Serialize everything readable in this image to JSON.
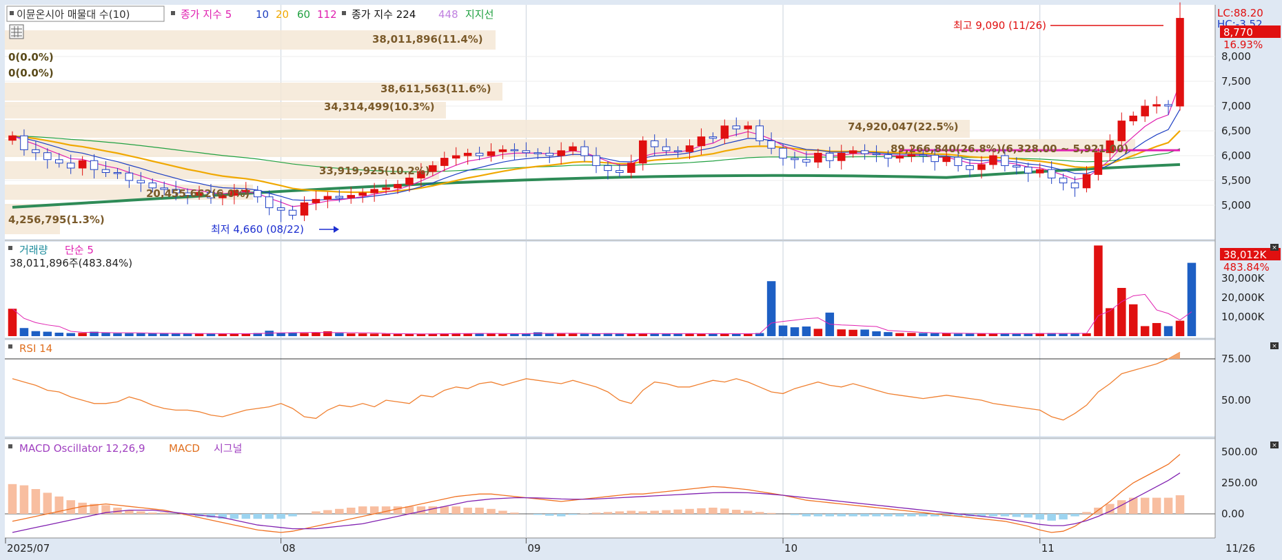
{
  "legend": {
    "item_name": "이뮨온시아 매물대 수(10)",
    "ma_label": "종가 지수 5",
    "ma10": "10",
    "ma20": "20",
    "ma60": "60",
    "ma112": "112",
    "ma224_label": "종가 지수 224",
    "ma448": "448",
    "support": "지지선"
  },
  "right_info": {
    "lc": "LC:88.20",
    "hc": "HC:-3.52",
    "price_tag": "8,770",
    "pct_tag": "16.93%"
  },
  "price_panel": {
    "high_label": "최고 9,090 (11/26)",
    "low_label": "최저 4,660 (08/22)",
    "y_ticks": [
      "8,000",
      "7,500",
      "7,000",
      "6,500",
      "6,000",
      "5,500",
      "5,000"
    ],
    "volume_profile": [
      {
        "label": "38,011,896(11.4%)"
      },
      {
        "label": "0(0.0%)"
      },
      {
        "label": "0(0.0%)"
      },
      {
        "label": "38,611,563(11.6%)"
      },
      {
        "label": "34,314,499(10.3%)"
      },
      {
        "label": "74,920,047(22.5%)"
      },
      {
        "label": "89,266,840(26.8%)(6,328.00 ~ 5,921.00)"
      },
      {
        "label": "33,919,925(10.2%)"
      },
      {
        "label": "20,455,662(6.0%)"
      },
      {
        "label": "4,256,795(1.3%)"
      }
    ]
  },
  "volume_panel": {
    "title": "거래량",
    "ma_label": "단순 5",
    "info": "38,011,896주(483.84%)",
    "y_ticks": [
      "30,000K",
      "20,000K",
      "10,000K"
    ],
    "tag_value": "38,012K",
    "tag_pct": "483.84%"
  },
  "rsi_panel": {
    "title": "RSI 14",
    "y_ticks": [
      "75.00",
      "50.00"
    ]
  },
  "macd_panel": {
    "title": "MACD Oscillator 12,26,9",
    "macd_label": "MACD",
    "signal_label": "시그널",
    "y_ticks": [
      "500.00",
      "250.00",
      "0.00"
    ]
  },
  "x_axis": {
    "labels": [
      "2025/07",
      "08",
      "09",
      "10",
      "11"
    ],
    "end_label": "11/26"
  },
  "chart_data": [
    {
      "type": "candlestick",
      "title": "이뮨온시아",
      "x": [
        "07/01",
        "07/02",
        "07/03",
        "07/04",
        "07/07",
        "07/08",
        "07/09",
        "07/10",
        "07/11",
        "07/14",
        "07/15",
        "07/16",
        "07/17",
        "07/18",
        "07/21",
        "07/22",
        "07/23",
        "07/24",
        "07/25",
        "07/28",
        "07/29",
        "07/30",
        "07/31",
        "08/01",
        "08/04",
        "08/05",
        "08/06",
        "08/07",
        "08/08",
        "08/11",
        "08/12",
        "08/13",
        "08/14",
        "08/18",
        "08/19",
        "08/20",
        "08/21",
        "08/22",
        "08/25",
        "08/26",
        "08/27",
        "08/28",
        "08/29",
        "09/01",
        "09/02",
        "09/03",
        "09/04",
        "09/05",
        "09/08",
        "09/09",
        "09/10",
        "09/11",
        "09/12",
        "09/15",
        "09/16",
        "09/17",
        "09/18",
        "09/19",
        "09/22",
        "09/23",
        "09/24",
        "09/25",
        "09/26",
        "09/29",
        "09/30",
        "10/01",
        "10/02",
        "10/10",
        "10/13",
        "10/14",
        "10/15",
        "10/16",
        "10/17",
        "10/20",
        "10/21",
        "10/22",
        "10/23",
        "10/24",
        "10/27",
        "10/28",
        "10/29",
        "10/30",
        "10/31",
        "11/03",
        "11/04",
        "11/05",
        "11/06",
        "11/07",
        "11/10",
        "11/11",
        "11/12",
        "11/13",
        "11/14",
        "11/17",
        "11/18",
        "11/19",
        "11/20",
        "11/21",
        "11/24",
        "11/25",
        "11/26"
      ],
      "open": [
        6310,
        6400,
        6120,
        6060,
        5920,
        5850,
        5750,
        5900,
        5720,
        5660,
        5650,
        5500,
        5450,
        5350,
        5320,
        5250,
        5200,
        5260,
        5150,
        5200,
        5300,
        5300,
        5170,
        4950,
        4900,
        4800,
        5050,
        5120,
        5180,
        5150,
        5200,
        5250,
        5320,
        5350,
        5420,
        5550,
        5680,
        5800,
        5950,
        6000,
        6050,
        6000,
        6080,
        6120,
        6100,
        6060,
        6050,
        6000,
        6100,
        6180,
        6000,
        5800,
        5700,
        5660,
        5850,
        6300,
        6180,
        6100,
        6080,
        6200,
        6380,
        6350,
        6600,
        6540,
        6600,
        6300,
        6150,
        5950,
        5920,
        5870,
        6050,
        5900,
        6050,
        6100,
        6040,
        6020,
        5950,
        5990,
        6020,
        6010,
        5880,
        5970,
        5800,
        5720,
        5820,
        6000,
        5800,
        5770,
        5650,
        5720,
        5550,
        5450,
        5350,
        5620,
        6060,
        6300,
        6700,
        6800,
        7000,
        7030,
        7000
      ],
      "close": [
        6400,
        6120,
        6060,
        5920,
        5850,
        5750,
        5900,
        5720,
        5660,
        5650,
        5500,
        5450,
        5350,
        5320,
        5250,
        5200,
        5260,
        5150,
        5200,
        5300,
        5300,
        5170,
        4950,
        4900,
        4800,
        5050,
        5120,
        5180,
        5150,
        5200,
        5250,
        5320,
        5350,
        5420,
        5550,
        5680,
        5800,
        5950,
        6000,
        6050,
        6000,
        6080,
        6120,
        6100,
        6060,
        6050,
        6000,
        6100,
        6180,
        6000,
        5800,
        5700,
        5660,
        5850,
        6300,
        6180,
        6100,
        6080,
        6200,
        6380,
        6350,
        6600,
        6540,
        6600,
        6300,
        6150,
        5950,
        5920,
        5870,
        6050,
        5900,
        6050,
        6100,
        6040,
        6020,
        5950,
        5990,
        6020,
        6010,
        5880,
        5970,
        5800,
        5720,
        5820,
        6000,
        5800,
        5770,
        5650,
        5720,
        5550,
        5450,
        5350,
        5620,
        6060,
        6300,
        6700,
        6800,
        7000,
        7030,
        7000,
        8770
      ],
      "high": 9090,
      "low": 4660,
      "ma_series": [
        {
          "name": "5",
          "color": "#e020b0"
        },
        {
          "name": "10",
          "color": "#1d3fc4"
        },
        {
          "name": "20",
          "color": "#f0a800"
        },
        {
          "name": "60",
          "color": "#20a040"
        },
        {
          "name": "112",
          "color": "#e020b0"
        },
        {
          "name": "224",
          "color": "#2e8b57"
        }
      ],
      "ylim": [
        4660,
        9090
      ]
    },
    {
      "type": "bar",
      "title": "거래량",
      "ylabel": "K",
      "values": [
        14200,
        4200,
        2600,
        2300,
        1800,
        1600,
        1700,
        2300,
        1700,
        1500,
        1500,
        1500,
        1400,
        1400,
        1300,
        1400,
        1300,
        1300,
        1200,
        1200,
        1300,
        1600,
        2800,
        1600,
        1700,
        1600,
        1800,
        2500,
        1600,
        1400,
        1400,
        1300,
        1200,
        1100,
        1100,
        1200,
        1300,
        1400,
        1500,
        1400,
        1300,
        1300,
        1200,
        1200,
        1400,
        2000,
        1400,
        1300,
        1300,
        1200,
        1300,
        1500,
        1300,
        1200,
        1300,
        1300,
        1300,
        1400,
        1300,
        1200,
        1300,
        1200,
        1300,
        1300,
        1600,
        28500,
        5500,
        4600,
        5000,
        3800,
        12200,
        3500,
        3300,
        3400,
        2500,
        2100,
        1600,
        1700,
        1600,
        1500,
        1400,
        1300,
        1400,
        1300,
        1400,
        1400,
        1200,
        1300,
        1500,
        1600,
        1400,
        1300,
        1500,
        47000,
        14500,
        25000,
        16500,
        5200,
        6800,
        5200,
        8000,
        38012
      ]
    },
    {
      "type": "line",
      "title": "RSI 14",
      "ylim": [
        30,
        85
      ],
      "values": [
        63,
        61,
        59,
        56,
        55,
        52,
        50,
        48,
        48,
        49,
        52,
        50,
        47,
        45,
        44,
        44,
        43,
        41,
        40,
        42,
        44,
        45,
        46,
        48,
        45,
        40,
        39,
        44,
        47,
        46,
        48,
        46,
        50,
        49,
        48,
        53,
        52,
        56,
        58,
        57,
        60,
        61,
        59,
        61,
        63,
        62,
        61,
        60,
        62,
        60,
        58,
        55,
        50,
        48,
        56,
        61,
        60,
        58,
        58,
        60,
        62,
        61,
        63,
        61,
        58,
        55,
        54,
        57,
        59,
        61,
        59,
        58,
        60,
        58,
        56,
        54,
        53,
        52,
        51,
        52,
        53,
        52,
        51,
        50,
        48,
        47,
        46,
        45,
        44,
        40,
        38,
        42,
        47,
        55,
        60,
        66,
        68,
        70,
        72,
        75,
        79
      ]
    },
    {
      "type": "line",
      "title": "MACD Oscillator 12,26,9",
      "series": [
        {
          "name": "MACD",
          "values": [
            -60,
            -40,
            -20,
            0,
            20,
            40,
            60,
            70,
            80,
            70,
            60,
            50,
            40,
            30,
            10,
            -10,
            -30,
            -50,
            -70,
            -90,
            -110,
            -130,
            -140,
            -150,
            -140,
            -120,
            -100,
            -80,
            -60,
            -40,
            -20,
            0,
            20,
            40,
            60,
            80,
            100,
            120,
            140,
            150,
            160,
            160,
            150,
            140,
            130,
            120,
            110,
            100,
            110,
            120,
            130,
            140,
            150,
            160,
            160,
            170,
            180,
            190,
            200,
            210,
            220,
            215,
            205,
            195,
            180,
            165,
            150,
            130,
            110,
            100,
            90,
            80,
            70,
            60,
            50,
            40,
            30,
            20,
            10,
            0,
            -10,
            -20,
            -30,
            -40,
            -50,
            -60,
            -80,
            -100,
            -130,
            -150,
            -140,
            -100,
            -40,
            30,
            100,
            180,
            250,
            300,
            350,
            400,
            480
          ]
        },
        {
          "name": "시그널",
          "values": [
            -150,
            -130,
            -110,
            -90,
            -70,
            -50,
            -30,
            -10,
            10,
            20,
            30,
            30,
            30,
            20,
            10,
            0,
            -10,
            -20,
            -30,
            -50,
            -70,
            -90,
            -100,
            -110,
            -120,
            -120,
            -120,
            -110,
            -100,
            -90,
            -80,
            -60,
            -40,
            -20,
            0,
            20,
            40,
            60,
            80,
            100,
            110,
            120,
            125,
            130,
            130,
            128,
            125,
            120,
            118,
            118,
            120,
            125,
            130,
            135,
            140,
            145,
            150,
            155,
            160,
            165,
            170,
            172,
            172,
            170,
            165,
            158,
            150,
            140,
            130,
            120,
            110,
            100,
            90,
            80,
            70,
            60,
            50,
            40,
            30,
            20,
            10,
            0,
            -10,
            -20,
            -30,
            -40,
            -55,
            -70,
            -85,
            -95,
            -95,
            -80,
            -55,
            -20,
            20,
            70,
            120,
            170,
            220,
            270,
            330
          ]
        },
        {
          "name": "MACD Oscillator 12,26,9",
          "values": [
            240,
            230,
            200,
            170,
            140,
            110,
            90,
            80,
            70,
            50,
            30,
            20,
            10,
            10,
            0,
            -10,
            -20,
            -30,
            -40,
            -40,
            -40,
            -40,
            -40,
            -40,
            -20,
            0,
            20,
            30,
            40,
            50,
            60,
            60,
            60,
            60,
            60,
            60,
            60,
            60,
            60,
            50,
            50,
            40,
            25,
            10,
            0,
            -8,
            -15,
            -20,
            -8,
            2,
            10,
            15,
            20,
            25,
            20,
            25,
            30,
            35,
            40,
            45,
            50,
            43,
            33,
            25,
            15,
            7,
            0,
            -10,
            -20,
            -20,
            -20,
            -20,
            -20,
            -20,
            -20,
            -20,
            -20,
            -20,
            -20,
            -20,
            -20,
            -20,
            -20,
            -20,
            -20,
            -20,
            -25,
            -30,
            -45,
            -55,
            -45,
            -20,
            15,
            50,
            80,
            110,
            130,
            130,
            130,
            130,
            150
          ]
        }
      ]
    }
  ]
}
